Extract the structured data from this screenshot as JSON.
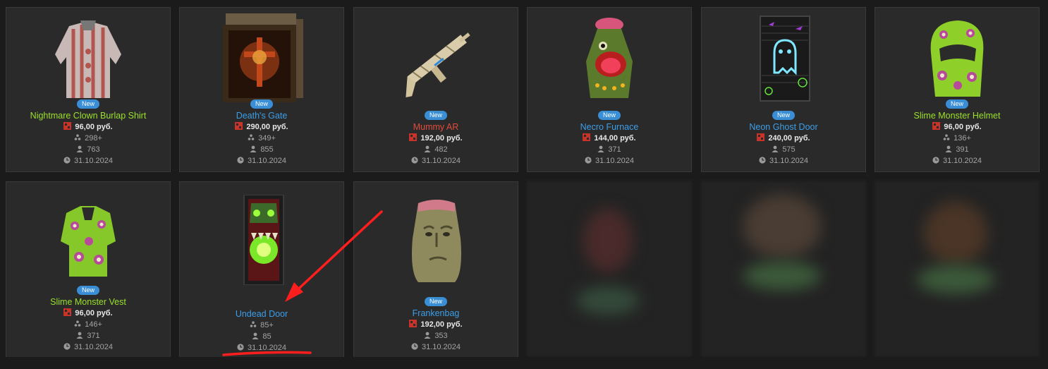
{
  "items": [
    {
      "name": "Nightmare Clown Burlap Shirt",
      "name_color": "#9be02a",
      "badge": "New",
      "price": "96,00 руб.",
      "stack": "298+",
      "users": "763",
      "date": "31.10.2024"
    },
    {
      "name": "Death's Gate",
      "name_color": "#3c9ee8",
      "badge": "New",
      "price": "290,00 руб.",
      "stack": "349+",
      "users": "855",
      "date": "31.10.2024"
    },
    {
      "name": "Mummy AR",
      "name_color": "#e14b3b",
      "badge": "New",
      "price": "192,00 руб.",
      "stack": "",
      "users": "482",
      "date": "31.10.2024"
    },
    {
      "name": "Necro Furnace",
      "name_color": "#3c9ee8",
      "badge": "New",
      "price": "144,00 руб.",
      "stack": "",
      "users": "371",
      "date": "31.10.2024"
    },
    {
      "name": "Neon Ghost Door",
      "name_color": "#3c9ee8",
      "badge": "New",
      "price": "240,00 руб.",
      "stack": "",
      "users": "575",
      "date": "31.10.2024"
    },
    {
      "name": "Slime Monster Helmet",
      "name_color": "#9be02a",
      "badge": "New",
      "price": "96,00 руб.",
      "stack": "136+",
      "users": "391",
      "date": "31.10.2024"
    },
    {
      "name": "Slime Monster Vest",
      "name_color": "#9be02a",
      "badge": "New",
      "price": "96,00 руб.",
      "stack": "146+",
      "users": "371",
      "date": "31.10.2024"
    },
    {
      "name": "Undead Door",
      "name_color": "#3c9ee8",
      "badge": "",
      "price": "",
      "stack": "85+",
      "users": "85",
      "date": "31.10.2024"
    },
    {
      "name": "Frankenbag",
      "name_color": "#3c9ee8",
      "badge": "New",
      "price": "192,00 руб.",
      "stack": "",
      "users": "353",
      "date": "31.10.2024"
    }
  ],
  "annotation_color": "#ff1e1e"
}
